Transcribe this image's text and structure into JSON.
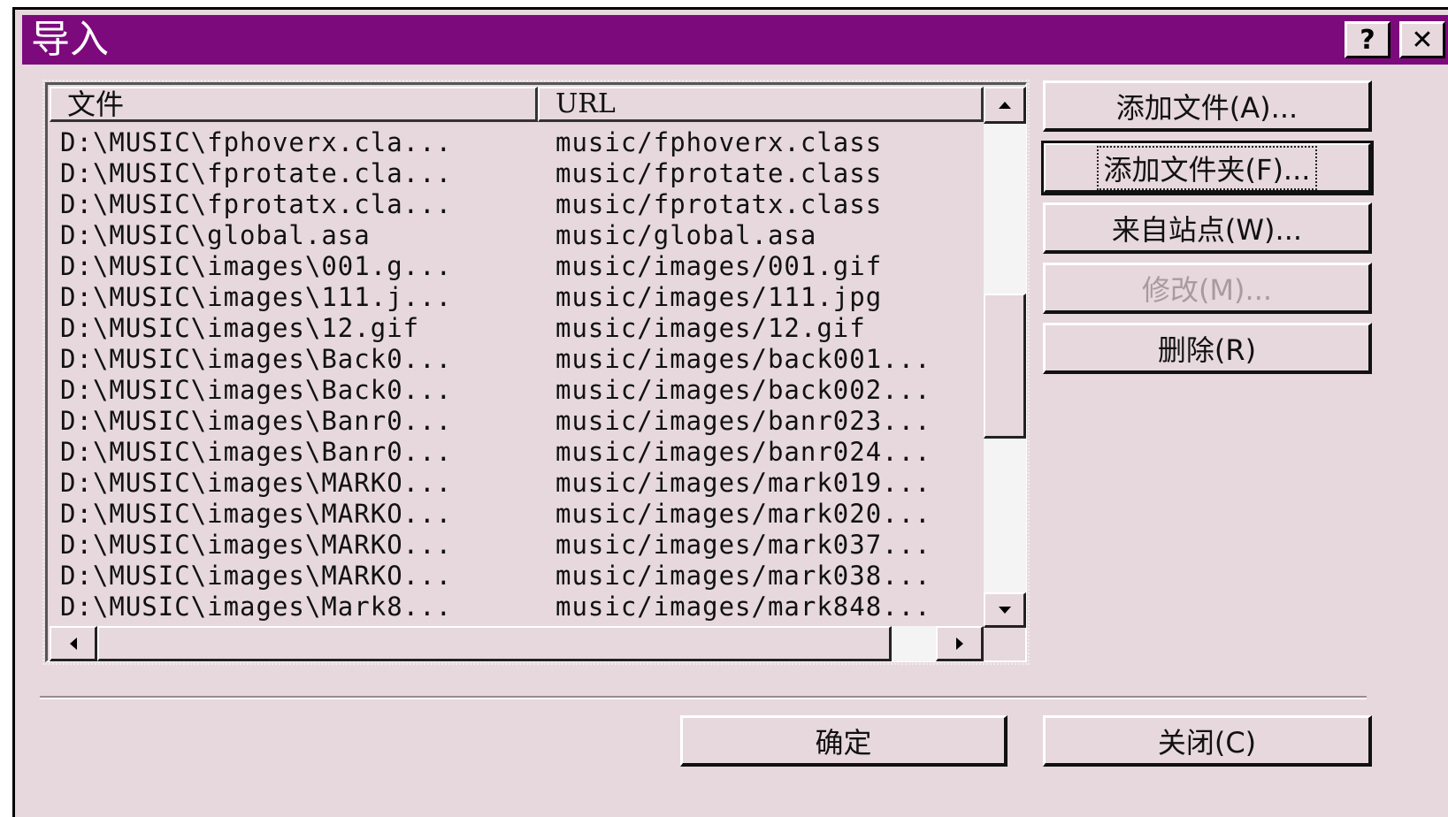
{
  "window": {
    "title": "导入",
    "help_label": "?",
    "close_label": "✕"
  },
  "list": {
    "headers": {
      "file": "文件",
      "url": "URL"
    },
    "rows": [
      {
        "file": "D:\\MUSIC\\fphoverx.cla...",
        "url": "music/fphoverx.class"
      },
      {
        "file": "D:\\MUSIC\\fprotate.cla...",
        "url": "music/fprotate.class"
      },
      {
        "file": "D:\\MUSIC\\fprotatx.cla...",
        "url": "music/fprotatx.class"
      },
      {
        "file": "D:\\MUSIC\\global.asa",
        "url": "music/global.asa"
      },
      {
        "file": "D:\\MUSIC\\images\\001.g...",
        "url": "music/images/001.gif"
      },
      {
        "file": "D:\\MUSIC\\images\\111.j...",
        "url": "music/images/111.jpg"
      },
      {
        "file": "D:\\MUSIC\\images\\12.gif",
        "url": "music/images/12.gif"
      },
      {
        "file": "D:\\MUSIC\\images\\Back0...",
        "url": "music/images/back001..."
      },
      {
        "file": "D:\\MUSIC\\images\\Back0...",
        "url": "music/images/back002..."
      },
      {
        "file": "D:\\MUSIC\\images\\Banr0...",
        "url": "music/images/banr023..."
      },
      {
        "file": "D:\\MUSIC\\images\\Banr0...",
        "url": "music/images/banr024..."
      },
      {
        "file": "D:\\MUSIC\\images\\MARKO...",
        "url": "music/images/mark019..."
      },
      {
        "file": "D:\\MUSIC\\images\\MARKO...",
        "url": "music/images/mark020..."
      },
      {
        "file": "D:\\MUSIC\\images\\MARKO...",
        "url": "music/images/mark037..."
      },
      {
        "file": "D:\\MUSIC\\images\\MARKO...",
        "url": "music/images/mark038..."
      },
      {
        "file": "D:\\MUSIC\\images\\Mark8...",
        "url": "music/images/mark848..."
      }
    ]
  },
  "buttons": {
    "add_file": "添加文件(A)...",
    "add_folder": "添加文件夹(F)...",
    "from_site": "来自站点(W)...",
    "modify": "修改(M)...",
    "delete": "删除(R)",
    "ok": "确定",
    "close": "关闭(C)"
  },
  "colors": {
    "titlebar": "#7c0a7c",
    "dialog_bg": "#e6d8dd",
    "disabled_text": "#a89aa0"
  }
}
